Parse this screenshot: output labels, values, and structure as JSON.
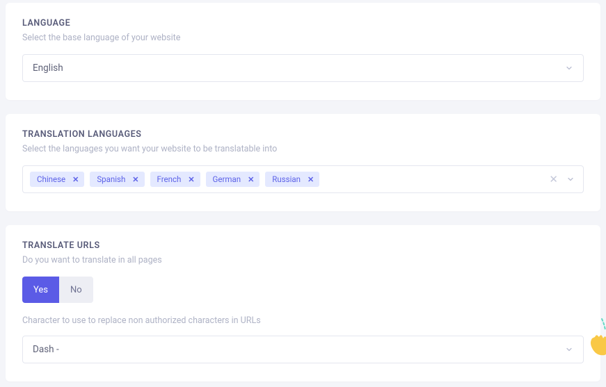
{
  "language": {
    "title": "LANGUAGE",
    "subtitle": "Select the base language of your website",
    "selected": "English"
  },
  "translation": {
    "title": "TRANSLATION LANGUAGES",
    "subtitle": "Select the languages you want your website to be translatable into",
    "tags": [
      "Chinese",
      "Spanish",
      "French",
      "German",
      "Russian"
    ]
  },
  "urls": {
    "title": "TRANSLATE URLS",
    "subtitle": "Do you want to translate in all pages",
    "yes": "Yes",
    "no": "No",
    "char_label": "Character to use to replace non authorized characters in URLs",
    "char_selected": "Dash -"
  }
}
